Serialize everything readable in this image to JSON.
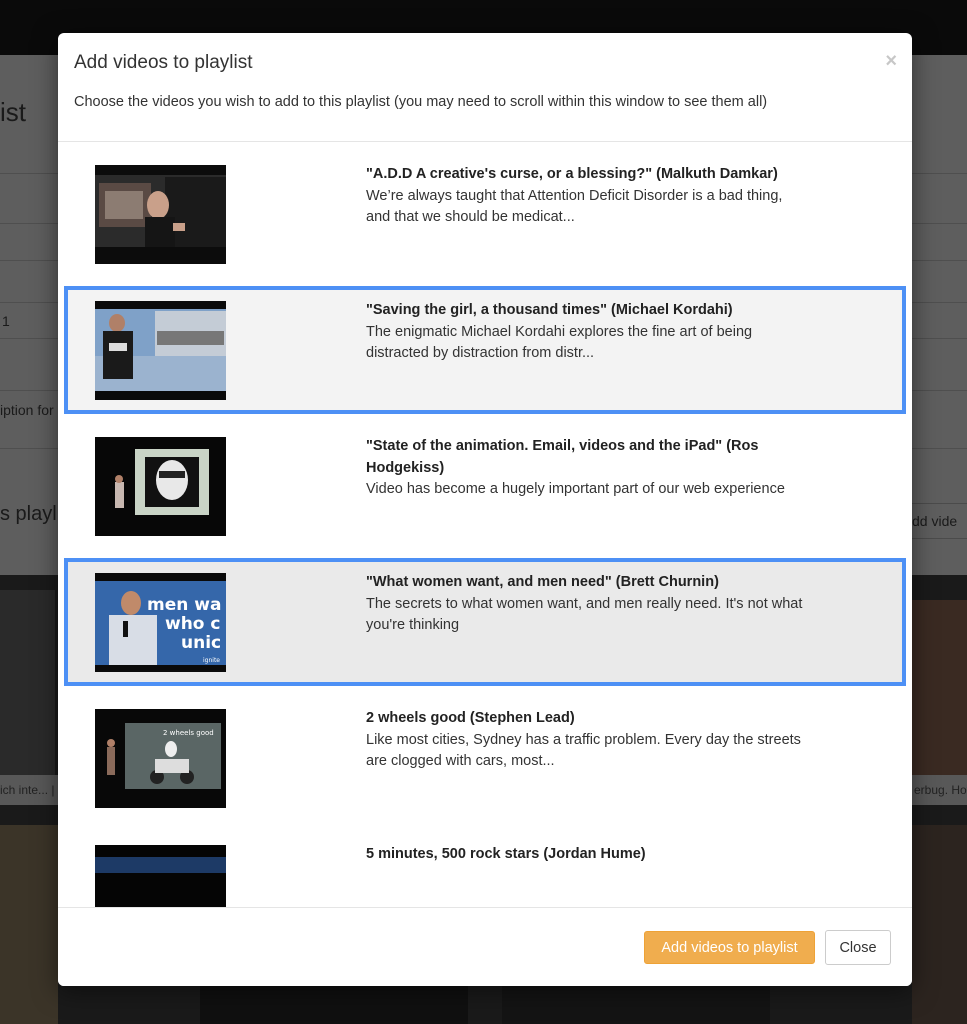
{
  "background": {
    "page_title_fragment": "ist",
    "row_number_fragment": "1",
    "description_fragment": "iption for",
    "section_title_fragment": "s playl",
    "add_video_fragment": "dd vide",
    "caption_left_fragment": "ich inte... | I",
    "caption_right_fragment": "erbug. Hov"
  },
  "modal": {
    "title": "Add videos to playlist",
    "close_symbol": "×",
    "subtitle": "Choose the videos you wish to add to this playlist (you may need to scroll within this window to see them all)",
    "videos": [
      {
        "title": "\"A.D.D A creative's curse, or a blessing?\" (Malkuth Damkar)",
        "description": "We’re always taught that Attention Deficit Disorder is a bad thing, and that we should be medicat...",
        "selected": false
      },
      {
        "title": "\"Saving the girl, a thousand times\" (Michael Kordahi)",
        "description": "The enigmatic Michael Kordahi explores the fine art of being distracted by distraction from distr...",
        "selected": true
      },
      {
        "title": "\"State of the animation. Email, videos and the iPad\" (Ros Hodgekiss)",
        "description": "Video has become a hugely important part of our web experience",
        "selected": false
      },
      {
        "title": "\"What women want, and men need\" (Brett Churnin)",
        "description": "The secrets to what women want, and men really need. It's not what you're thinking",
        "selected": true,
        "thumb_text_lines": [
          "men wa",
          "who c",
          "unic",
          "ignite"
        ]
      },
      {
        "title": "2 wheels good (Stephen Lead)",
        "description": "Like most cities, Sydney has a traffic problem. Every day the streets are clogged with cars, most...",
        "selected": false,
        "thumb_text": "2 wheels good"
      },
      {
        "title": "5 minutes, 500 rock stars (Jordan Hume)",
        "description": "",
        "selected": false
      }
    ],
    "footer": {
      "add_button": "Add videos to playlist",
      "close_button": "Close"
    }
  },
  "colors": {
    "selection_border": "#4d90f5",
    "primary_button": "#f0ad4e",
    "overlay_dim": "#5e5e5e"
  }
}
